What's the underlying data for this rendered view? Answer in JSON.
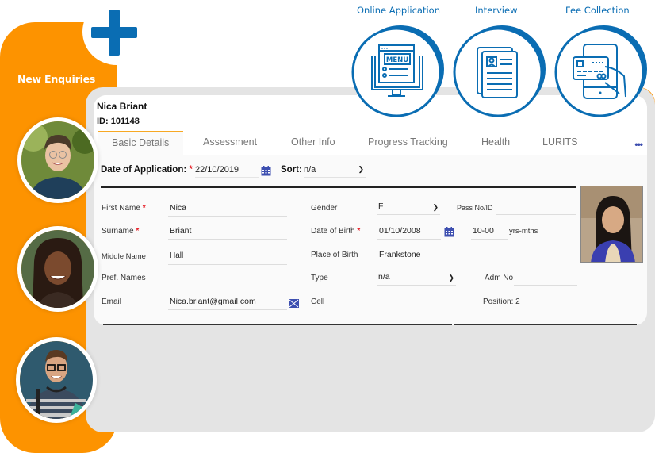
{
  "sidebar": {
    "title": "New Enquiries",
    "add_icon": "plus-icon",
    "avatars": [
      {
        "name": "avatar-student-1",
        "description": "young man with glasses, blue sweater"
      },
      {
        "name": "avatar-student-2",
        "description": "smiling young woman"
      },
      {
        "name": "avatar-student-3",
        "description": "young man with glasses and headphones"
      }
    ]
  },
  "process": [
    {
      "label": "Online Application",
      "icon": "menu-screen-icon"
    },
    {
      "label": "Interview",
      "icon": "profile-document-icon"
    },
    {
      "label": "Fee Collection",
      "icon": "card-payment-icon"
    }
  ],
  "student": {
    "name": "Nica Briant",
    "id": "ID: 101148"
  },
  "tabs": [
    {
      "label": "Basic Details",
      "active": true
    },
    {
      "label": "Assessment",
      "active": false
    },
    {
      "label": "Other Info",
      "active": false
    },
    {
      "label": "Progress Tracking",
      "active": false
    },
    {
      "label": "Health",
      "active": false
    },
    {
      "label": "LURITS",
      "active": false
    }
  ],
  "more_label": "•••",
  "header": {
    "doa_label": "Date of Application:",
    "required_mark": "*",
    "doa_value": "22/10/2019",
    "sort_label": "Sort:",
    "sort_value": "n/a"
  },
  "form": {
    "first_name_label": "First Name",
    "first_name": "Nica",
    "surname_label": "Surname",
    "surname": "Briant",
    "middle_name_label": "Middle Name",
    "middle_name": "Hall",
    "pref_names_label": "Pref. Names",
    "pref_names": "",
    "email_label": "Email",
    "email": "Nica.briant@gmail.com",
    "gender_label": "Gender",
    "gender": "F",
    "dob_label": "Date of Birth",
    "dob": "01/10/2008",
    "age": "10-00",
    "age_unit": "yrs-mths",
    "pob_label": "Place of Birth",
    "pob": "Frankstone",
    "type_label": "Type",
    "type": "n/a",
    "cell_label": "Cell",
    "cell": "",
    "pass_label": "Pass No/ID",
    "pass": "",
    "adm_label": "Adm No",
    "adm": "",
    "position": "Position: 2"
  },
  "colors": {
    "orange": "#fd9300",
    "blue": "#0a6db3",
    "required": "#e51b23",
    "tab_accent": "#f7a823"
  }
}
